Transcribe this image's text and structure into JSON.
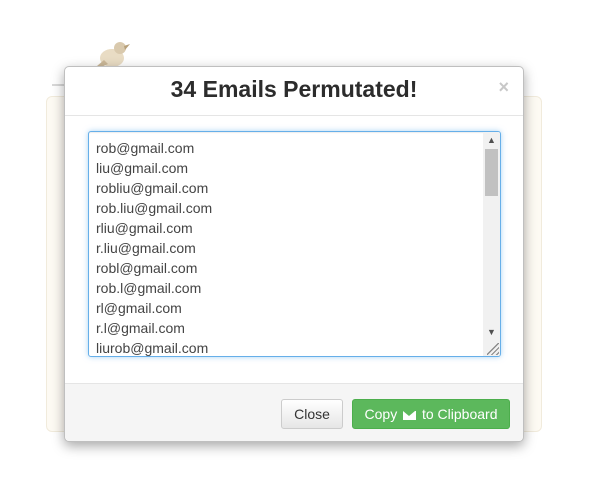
{
  "modal": {
    "title": "34 Emails Permutated!",
    "close_symbol": "×"
  },
  "emails": [
    "rob@gmail.com",
    "liu@gmail.com",
    "robliu@gmail.com",
    "rob.liu@gmail.com",
    "rliu@gmail.com",
    "r.liu@gmail.com",
    "robl@gmail.com",
    "rob.l@gmail.com",
    "rl@gmail.com",
    "r.l@gmail.com",
    "liurob@gmail.com"
  ],
  "footer": {
    "close_label": "Close",
    "copy_label_prefix": "Copy",
    "copy_label_suffix": "to Clipboard",
    "copy_icon": "envelope-icon"
  },
  "colors": {
    "primary_green": "#5cb85c",
    "focus_blue": "#66afe9",
    "title_text": "#2c2c2c"
  },
  "scrollbar": {
    "up_arrow": "▲",
    "down_arrow": "▼"
  }
}
